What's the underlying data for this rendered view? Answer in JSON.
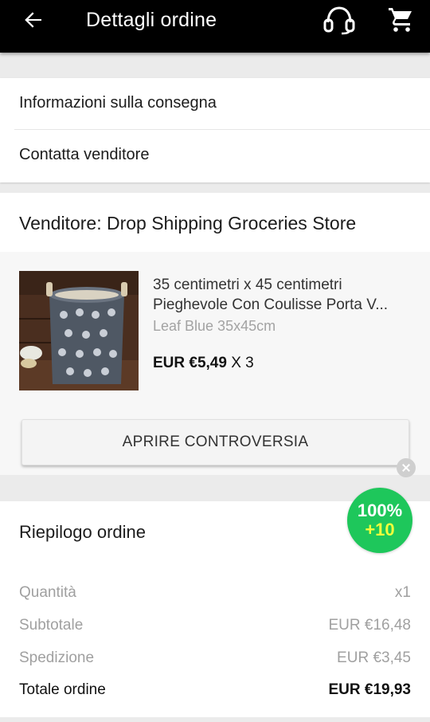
{
  "appbar": {
    "title": "Dettagli ordine",
    "icons": {
      "back": "arrow-back-icon",
      "support": "headset-icon",
      "cart": "cart-icon"
    }
  },
  "menu": {
    "items": [
      {
        "label": "Informazioni sulla consegna"
      },
      {
        "label": "Contatta venditore"
      }
    ]
  },
  "seller": {
    "name": "Venditore: Drop Shipping Groceries Store",
    "product": {
      "title": "35 centimetri x 45 centimetri Pieghevole Con Coulisse Porta V...",
      "variant": "Leaf Blue 35x45cm",
      "price": "EUR €5,49",
      "quantity": "X 3"
    },
    "dispute_button": "APRIRE CONTROVERSIA"
  },
  "badge": {
    "percent": "100%",
    "points": "+10",
    "color": "#1ec75b"
  },
  "summary": {
    "title": "Riepilogo ordine",
    "rows": [
      {
        "label": "Quantità",
        "value": "x1"
      },
      {
        "label": "Subtotale",
        "value": "EUR €16,48"
      },
      {
        "label": "Spedizione",
        "value": "EUR €3,45"
      },
      {
        "label": "Totale ordine",
        "value": "EUR €19,93"
      }
    ]
  },
  "colors": {
    "appbar": "#000000",
    "background": "#ebebeb",
    "muted_text": "#a0a0a0"
  }
}
